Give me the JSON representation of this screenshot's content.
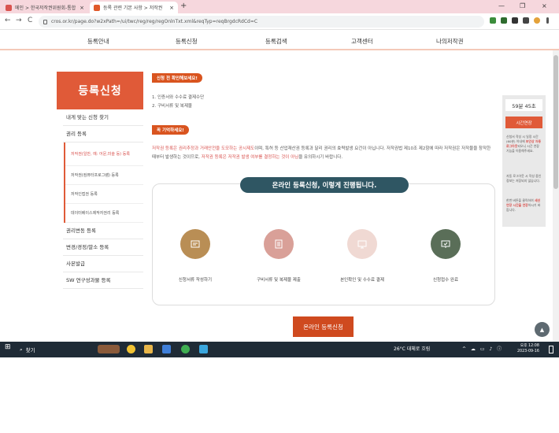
{
  "browser": {
    "tabs": [
      {
        "title": "메인 > 한국저작권위원회-통합",
        "close": "×"
      },
      {
        "title": "등록 관련 기본 사항 > 저작권",
        "close": "×"
      }
    ],
    "new_tab": "+",
    "window_controls": {
      "minimize": "—",
      "maximize": "❐",
      "close": "×"
    },
    "url": "cros.or.kr/page.do?w2xPath=/ui/twc/reg/reg/regOnlnTxt.xml&reqTyp=reqBrgdcRdCd=C",
    "nav": {
      "back": "←",
      "forward": "→",
      "reload": "C"
    }
  },
  "gnb": {
    "items": [
      "등록안내",
      "등록신청",
      "등록검색",
      "고객센터",
      "나의저작권"
    ]
  },
  "sidebar": {
    "title": "등록신청",
    "items": [
      {
        "label": "내게 맞는 신청 찾기"
      },
      {
        "label": "권리 등록"
      }
    ],
    "sub_items": [
      {
        "label": "저작권(일반, 예: 어문,미술 등) 등록",
        "active": true
      },
      {
        "label": "저작권(컴퓨터프로그램) 등록",
        "active": false
      },
      {
        "label": "저작인접권 등록",
        "active": false
      },
      {
        "label": "데이터베이스제작자권리 등록",
        "active": false
      }
    ],
    "items_after": [
      {
        "label": "권리변동 등록"
      },
      {
        "label": "변경/경정/말소 등록"
      },
      {
        "label": "사본발급"
      },
      {
        "label": "SW 연구성과물 등록"
      }
    ]
  },
  "main": {
    "check_title": "신청 전 확인해보세요!",
    "checklist": [
      "1. 인증서와 수수료 결제수단",
      "2. 구비서류 및 복제물"
    ],
    "remember_title": "꼭 기억하세요!",
    "paragraph": {
      "part1": "저작권 등록은 권리추정과 거래안전을 도모하는 공시제도",
      "part2": "이며, 특허 등 산업재산권 등록과 달리 권리의 효력발생 요건이 아닙니다. 저작권법 제10조 제2항에 따라 저작권은 저작물을 창작한 때부터 발생하는 것이므로, ",
      "part3": "저작권 등록은 저작권 발생 여부를 결정하는 것이 아님",
      "part4": "을 유의하시기 바랍니다."
    },
    "process_title": "온라인 등록신청, 이렇게 진행됩니다.",
    "steps": [
      {
        "label": "신청서류 작성하기",
        "color": "#b98e55",
        "icon": "document-icon"
      },
      {
        "label": "구비서류 및 복제물 제출",
        "color": "#d9a098",
        "icon": "files-icon"
      },
      {
        "label": "본인확인 및 수수료 결제",
        "color": "#f0d9d3",
        "icon": "monitor-icon"
      },
      {
        "label": "신청접수 완료",
        "color": "#5a6e58",
        "icon": "monitor-check-icon"
      }
    ],
    "cta": "온라인 등록신청"
  },
  "timer": {
    "countdown": "59분 45초",
    "extend_label": "시간연장",
    "note1_a": "신청서 작성 시 일정 시간(60분) 이내에 ",
    "note1_b": "보안상 자동 로그아웃",
    "note1_c": "되오니 시간 연장 기능을 이용해주세요.",
    "note2": "자동 로그아웃 시 작성 중인 정보는 저장되지 않습니다.",
    "note3_a": "한번 버튼을 클릭하여 ",
    "note3_b": "세션 연장 시간을 연장",
    "note3_c": "하시기 바랍니다."
  },
  "taskbar": {
    "start": "⊞",
    "search_icon": "⌕",
    "search_placeholder": "찾기",
    "weather": "26°C  대체로 흐림",
    "time": "오후 12:08",
    "date": "2023-09-16"
  },
  "colors": {
    "accent": "#e05a38",
    "dark_teal": "#2f5663",
    "tab_bar": "#f6d7dd",
    "taskbar": "#1f2b36"
  }
}
